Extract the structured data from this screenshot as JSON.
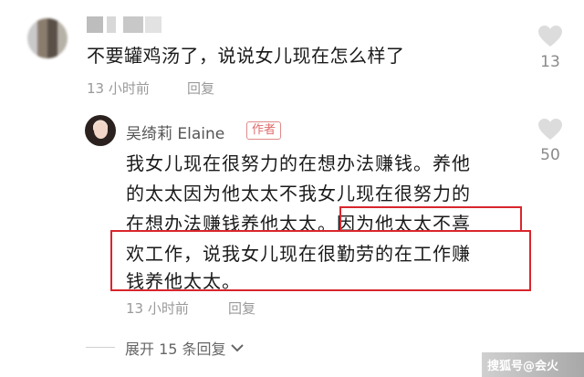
{
  "comment": {
    "text": "不要罐鸡汤了，说说女儿现在怎么样了",
    "time": "13 小时前",
    "reply_label": "回复",
    "likes": "13"
  },
  "reply": {
    "author": "吴绮莉 Elaine",
    "author_tag": "作者",
    "lines": [
      "我女儿现在很努力的在想办法赚钱。养他",
      "的太太因为他太太不我女儿现在很努力的",
      "在想办法赚钱养他太太。因为他太太不喜",
      "欢工作，说我女儿现在很勤劳的在工作赚",
      "钱养他太太。"
    ],
    "time": "13 小时前",
    "reply_label": "回复",
    "likes": "50"
  },
  "expand": {
    "label": "展开 15 条回复"
  },
  "watermark": {
    "text": "搜狐号@会火"
  },
  "colors": {
    "highlight_box": "#d9262c",
    "author_tag": "#e06a6a",
    "meta_gray": "#9a9a9a"
  }
}
